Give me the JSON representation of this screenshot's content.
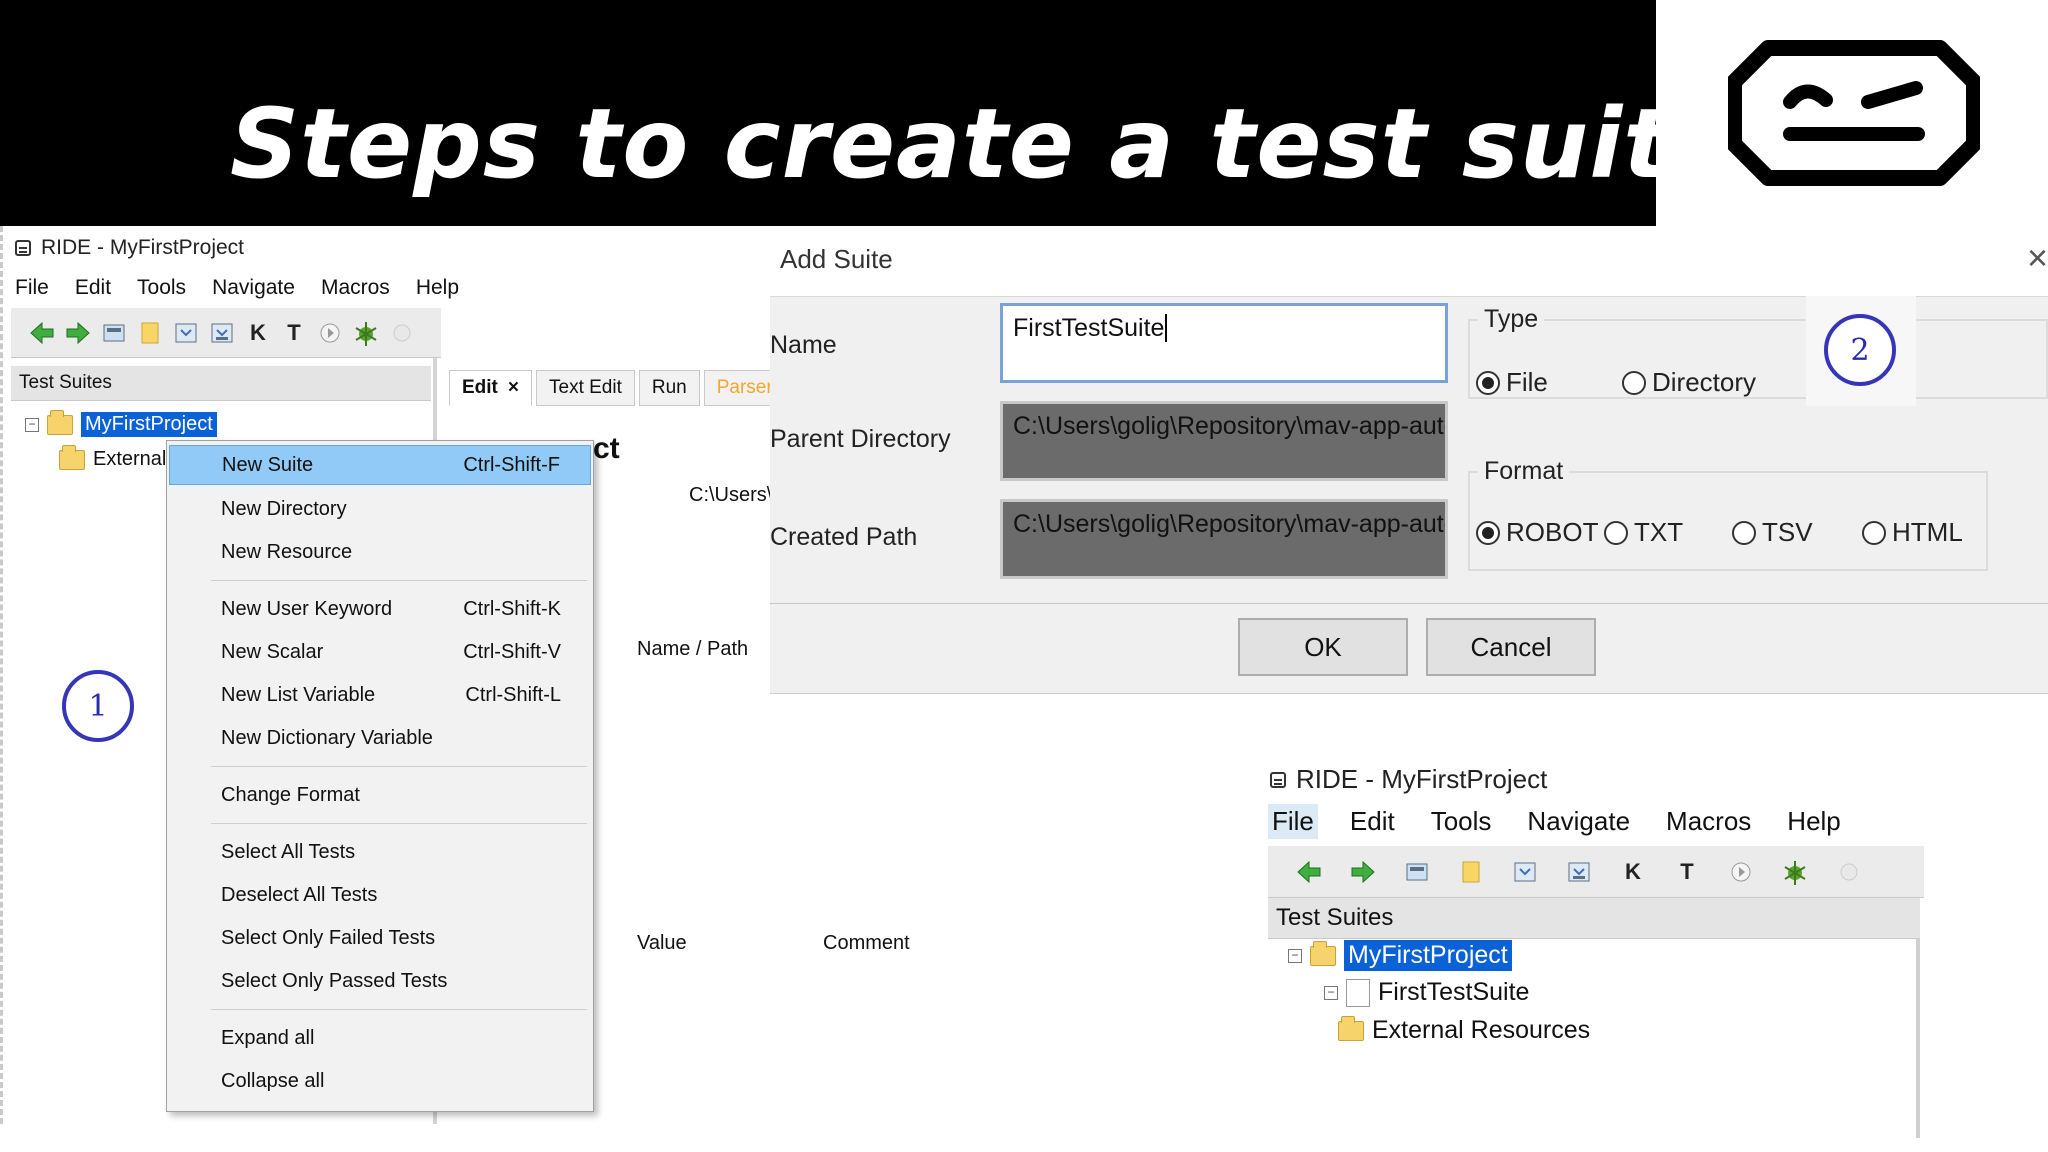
{
  "banner": {
    "title": "Steps to create a test suite"
  },
  "main_window": {
    "title": "RIDE - MyFirstProject",
    "menu": [
      "File",
      "Edit",
      "Tools",
      "Navigate",
      "Macros",
      "Help"
    ],
    "panel_title": "Test Suites",
    "tree": {
      "project": "MyFirstProject",
      "external": "External R"
    },
    "tabs": [
      "Edit",
      "Text Edit",
      "Run",
      "Parser L"
    ],
    "tab_close": "×",
    "heading_partial": "ct",
    "path_partial": "C:\\Users\\g",
    "columns": {
      "name_path": "Name / Path",
      "value": "Value",
      "comment": "Comment"
    }
  },
  "context_menu": {
    "items": [
      {
        "label": "New Suite",
        "shortcut": "Ctrl-Shift-F"
      },
      {
        "label": "New Directory",
        "shortcut": ""
      },
      {
        "label": "New Resource",
        "shortcut": ""
      },
      {
        "label": "New User Keyword",
        "shortcut": "Ctrl-Shift-K"
      },
      {
        "label": "New Scalar",
        "shortcut": "Ctrl-Shift-V"
      },
      {
        "label": "New List Variable",
        "shortcut": "Ctrl-Shift-L"
      },
      {
        "label": "New Dictionary Variable",
        "shortcut": ""
      },
      {
        "label": "Change Format",
        "shortcut": ""
      },
      {
        "label": "Select All Tests",
        "shortcut": ""
      },
      {
        "label": "Deselect All Tests",
        "shortcut": ""
      },
      {
        "label": "Select Only Failed Tests",
        "shortcut": ""
      },
      {
        "label": "Select Only Passed Tests",
        "shortcut": ""
      },
      {
        "label": "Expand all",
        "shortcut": ""
      },
      {
        "label": "Collapse all",
        "shortcut": ""
      }
    ]
  },
  "badges": {
    "step1": "1",
    "step2": "2"
  },
  "dialog": {
    "title": "Add Suite",
    "close": "×",
    "name_label": "Name",
    "name_value": "FirstTestSuite",
    "parent_label": "Parent Directory",
    "parent_value": "C:\\Users\\golig\\Repository\\mav-app-auto",
    "created_label": "Created Path",
    "created_value": "C:\\Users\\golig\\Repository\\mav-app-auto",
    "type_title": "Type",
    "type_options": [
      "File",
      "Directory"
    ],
    "type_selected": "File",
    "format_title": "Format",
    "format_options": [
      "ROBOT",
      "TXT",
      "TSV",
      "HTML"
    ],
    "format_selected": "ROBOT",
    "ok": "OK",
    "cancel": "Cancel"
  },
  "result_window": {
    "title": "RIDE - MyFirstProject",
    "menu": [
      "File",
      "Edit",
      "Tools",
      "Navigate",
      "Macros",
      "Help"
    ],
    "panel_title": "Test Suites",
    "tree": {
      "project": "MyFirstProject",
      "suite": "FirstTestSuite",
      "external": "External Resources"
    }
  },
  "colors": {
    "banner": "#000000",
    "selection": "#0a62d6",
    "menu_highlight": "#91c9f7",
    "badge": "#3535b8",
    "readonly_field": "#6b6b6b"
  }
}
